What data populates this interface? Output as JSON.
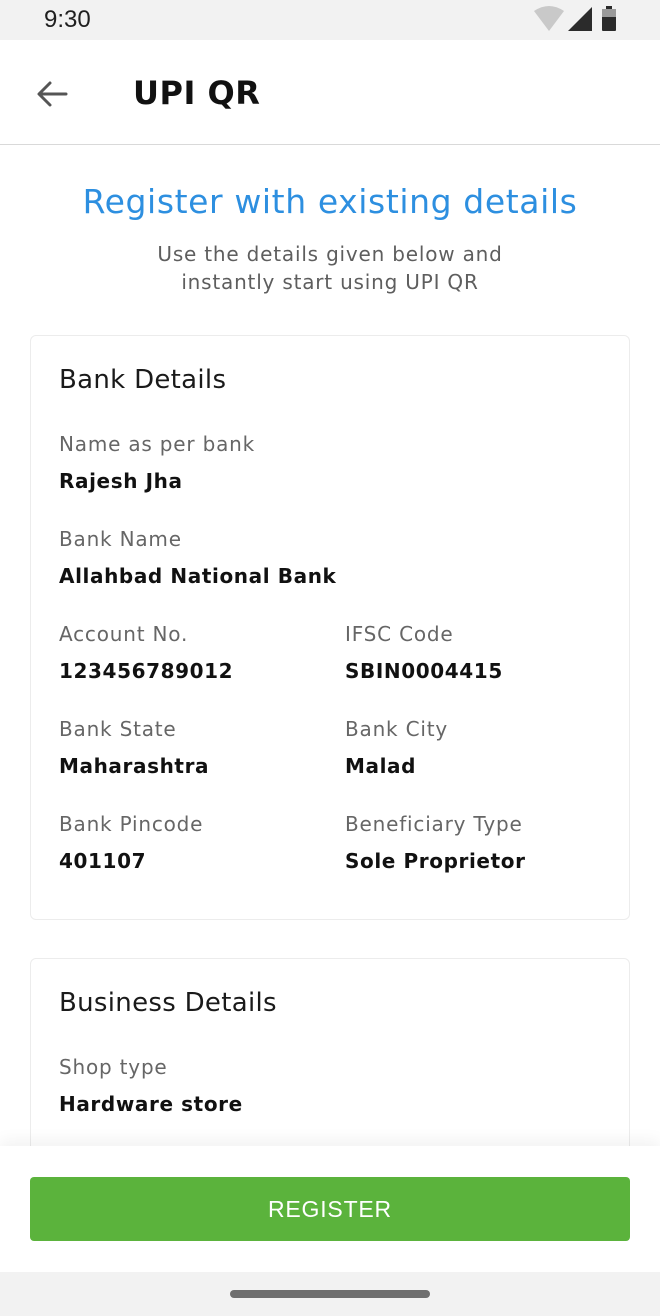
{
  "status": {
    "time": "9:30",
    "icons": [
      "wifi-icon",
      "signal-icon",
      "battery-icon"
    ]
  },
  "app_bar": {
    "title": "UPI QR",
    "back_icon": "arrow-left-icon"
  },
  "hero": {
    "title": "Register with existing details",
    "subtitle_line1": "Use the details given below and",
    "subtitle_line2": "instantly start using UPI QR"
  },
  "bank_details": {
    "title": "Bank Details",
    "name_label": "Name as per bank",
    "name_value": "Rajesh Jha",
    "bank_name_label": "Bank Name",
    "bank_name_value": "Allahbad National Bank",
    "account_label": "Account No.",
    "account_value": "123456789012",
    "ifsc_label": "IFSC Code",
    "ifsc_value": "SBIN0004415",
    "state_label": "Bank State",
    "state_value": "Maharashtra",
    "city_label": "Bank City",
    "city_value": "Malad",
    "pincode_label": "Bank Pincode",
    "pincode_value": "401107",
    "beneficiary_label": "Beneficiary Type",
    "beneficiary_value": "Sole Proprietor"
  },
  "business_details": {
    "title": "Business Details",
    "shop_type_label": "Shop type",
    "shop_type_value": "Hardware store"
  },
  "footer": {
    "register_label": "REGISTER"
  },
  "colors": {
    "accent": "#2d8fe0",
    "button": "#5bb33c"
  }
}
